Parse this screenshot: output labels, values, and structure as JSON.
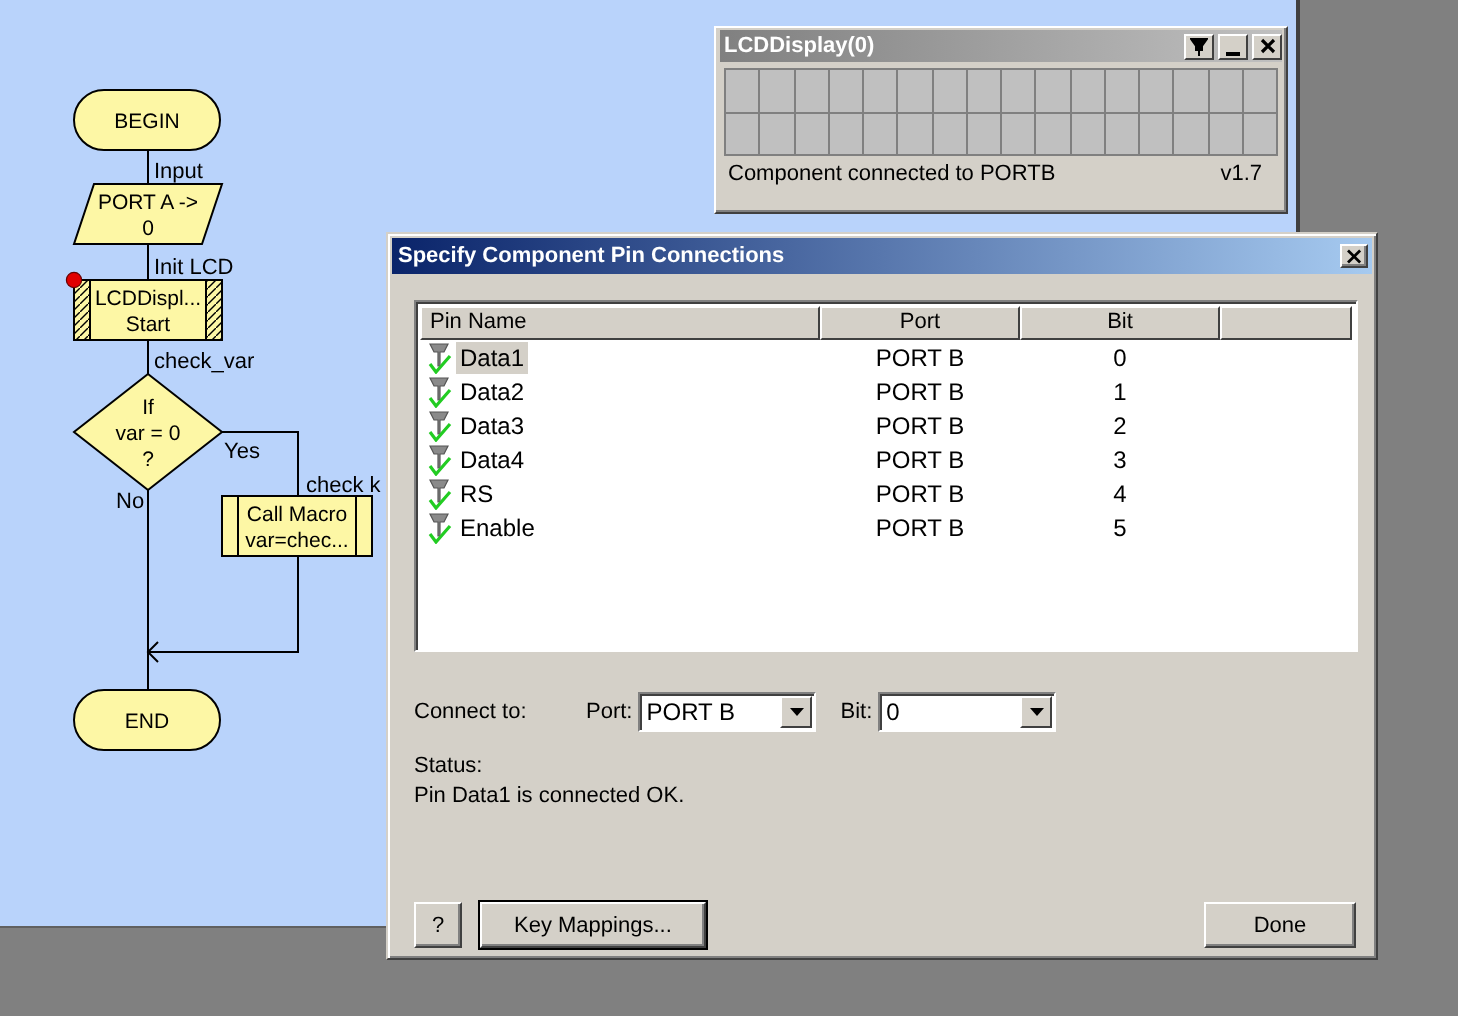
{
  "flowchart": {
    "nodes": [
      {
        "kind": "terminal",
        "text": [
          "BEGIN"
        ]
      },
      {
        "kind": "io",
        "label": "Input",
        "text": [
          "PORT A ->",
          "0"
        ]
      },
      {
        "kind": "macro",
        "label": "Init LCD",
        "text": [
          "LCDDispl...",
          "Start"
        ],
        "breakpoint": true
      },
      {
        "kind": "decision",
        "label": "check_var",
        "text": [
          "If",
          "var = 0",
          "?"
        ],
        "yes": "Yes",
        "no": "No"
      },
      {
        "kind": "call",
        "label": "check k",
        "text": [
          "Call Macro",
          "var=chec..."
        ]
      },
      {
        "kind": "terminal",
        "text": [
          "END"
        ]
      }
    ]
  },
  "lcd_window": {
    "title": "LCDDisplay(0)",
    "status": "Component connected to PORTB",
    "version": "v1.7"
  },
  "dialog": {
    "title": "Specify Component Pin Connections",
    "close": "×",
    "columns": [
      "Pin Name",
      "Port",
      "Bit"
    ],
    "rows": [
      {
        "pin": "Data1",
        "port": "PORT B",
        "bit": "0",
        "selected": true
      },
      {
        "pin": "Data2",
        "port": "PORT B",
        "bit": "1",
        "selected": false
      },
      {
        "pin": "Data3",
        "port": "PORT B",
        "bit": "2",
        "selected": false
      },
      {
        "pin": "Data4",
        "port": "PORT B",
        "bit": "3",
        "selected": false
      },
      {
        "pin": "RS",
        "port": "PORT B",
        "bit": "4",
        "selected": false
      },
      {
        "pin": "Enable",
        "port": "PORT B",
        "bit": "5",
        "selected": false
      }
    ],
    "connect_label": "Connect to:",
    "port_label": "Port:",
    "port_value": "PORT B",
    "bit_label": "Bit:",
    "bit_value": "0",
    "status_label": "Status:",
    "status_text": "Pin Data1 is connected OK.",
    "buttons": [
      {
        "kind": "help",
        "label": "?"
      },
      {
        "kind": "left",
        "label": "Key Mappings..."
      },
      {
        "kind": "right",
        "label": "Done"
      }
    ]
  }
}
